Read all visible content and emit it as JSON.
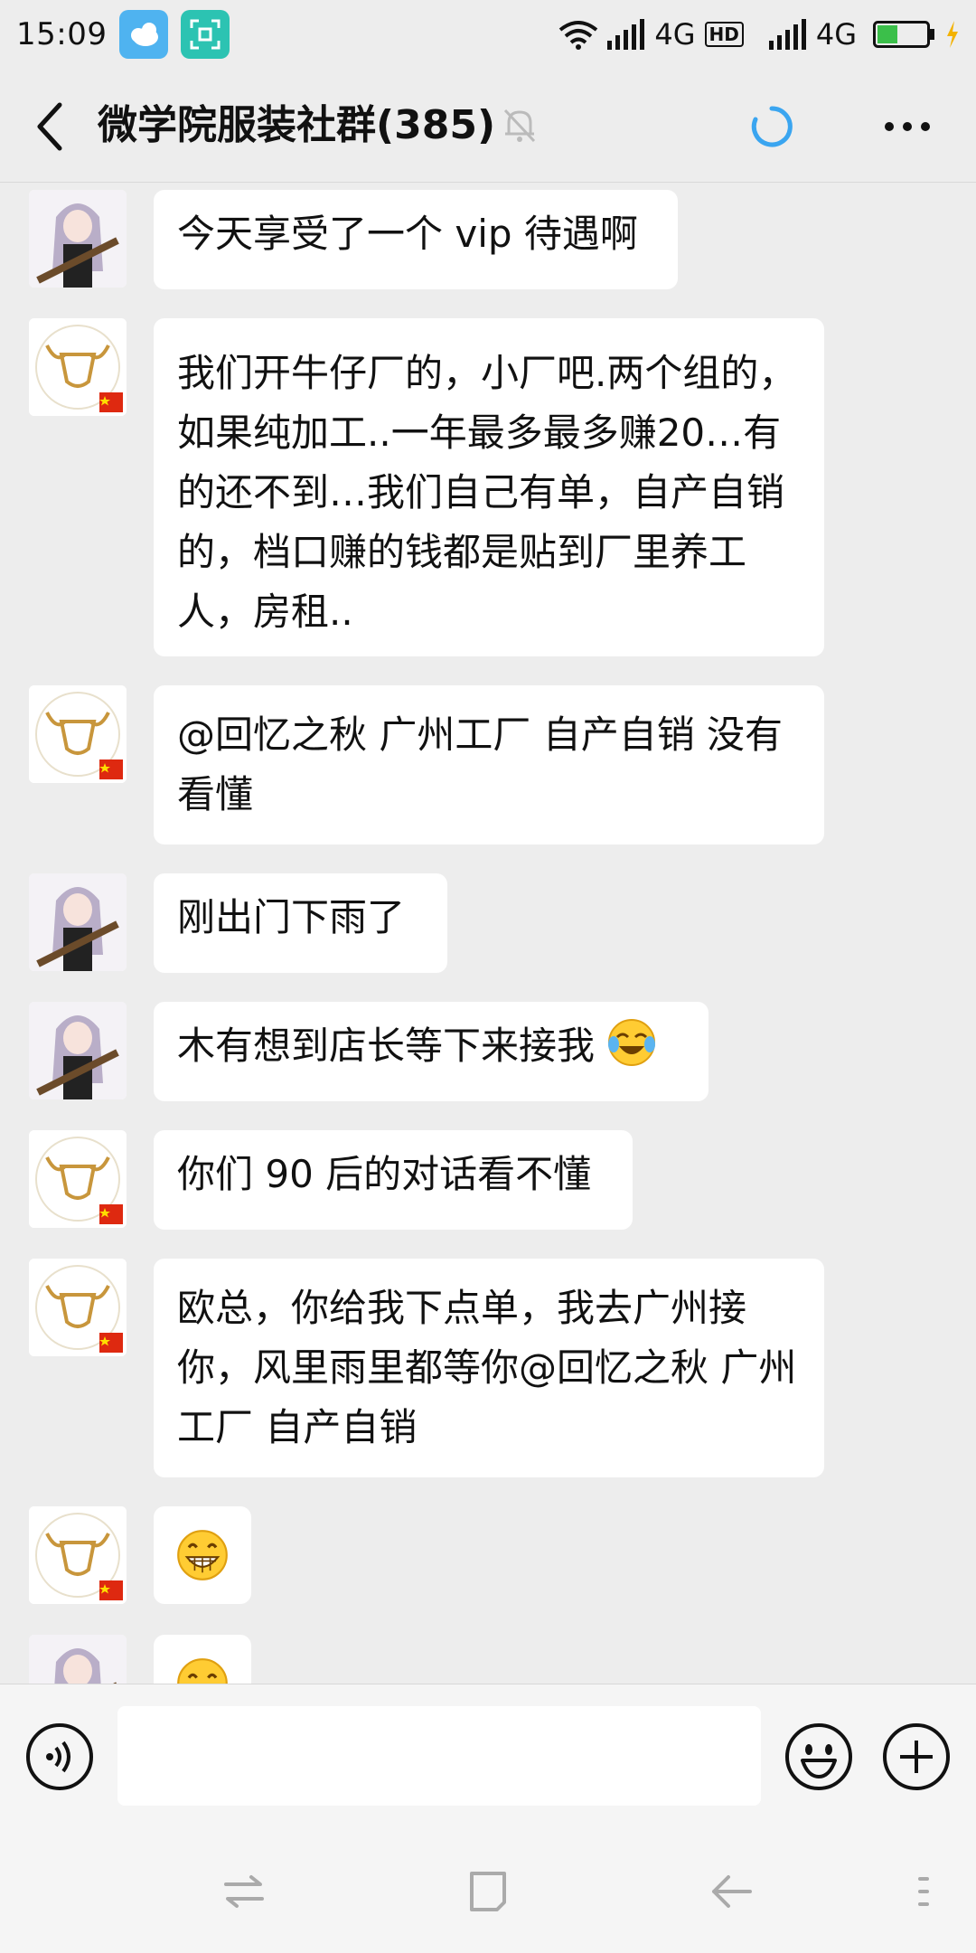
{
  "status_bar": {
    "time": "15:09",
    "network_1": "4G",
    "hd": "HD",
    "network_2": "4G",
    "battery_color": "#3bbf4a",
    "icons": [
      "weather-icon",
      "scan-icon",
      "wifi-icon",
      "signal-icon",
      "hd-icon",
      "signal-icon",
      "battery-icon",
      "charging-icon"
    ]
  },
  "header": {
    "title": "微学院服装社群(385)",
    "icons": [
      "back-icon",
      "mute-bell-icon",
      "loading-icon",
      "more-icon"
    ],
    "accent_color": "#3aa5f0"
  },
  "messages": [
    {
      "avatar": "anime-girl-avatar",
      "text": "今天享受了一个 vip 待遇啊"
    },
    {
      "avatar": "bull-logo-avatar",
      "text": "我们开牛仔厂的，小厂吧.两个组的，如果纯加工..一年最多最多赚20…有的还不到…我们自己有单，自产自销的，档口赚的钱都是贴到厂里养工人，房租.."
    },
    {
      "avatar": "bull-logo-avatar",
      "text": "@回忆之秋 广州工厂 自产自销  没有看懂"
    },
    {
      "avatar": "anime-girl-avatar",
      "text": "刚出门下雨了"
    },
    {
      "avatar": "anime-girl-avatar",
      "text": "木有想到店长等下来接我",
      "emoji": "crying-laughing-emoji"
    },
    {
      "avatar": "bull-logo-avatar",
      "text": "你们 90 后的对话看不懂"
    },
    {
      "avatar": "bull-logo-avatar",
      "text": "欧总，你给我下点单，我去广州接你，风里雨里都等你@回忆之秋 广州工厂 自产自销"
    },
    {
      "avatar": "bull-logo-avatar",
      "emoji": "grinning-emoji"
    },
    {
      "avatar": "anime-girl-avatar",
      "emoji": "smiling-emoji"
    }
  ],
  "input_bar": {
    "value": "",
    "placeholder": "",
    "icons": [
      "voice-icon",
      "emoji-icon",
      "plus-icon"
    ]
  },
  "nav_bar": {
    "icons": [
      "switch-icon",
      "home-icon",
      "back-nav-icon",
      "menu-icon"
    ]
  }
}
